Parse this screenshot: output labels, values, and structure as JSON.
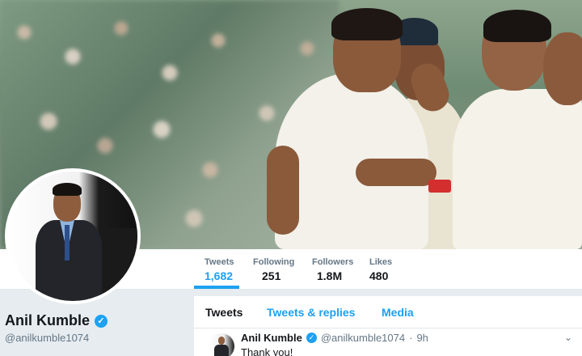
{
  "profile": {
    "name": "Anil Kumble",
    "handle": "@anilkumble1074"
  },
  "stats": [
    {
      "label": "Tweets",
      "value": "1,682"
    },
    {
      "label": "Following",
      "value": "251"
    },
    {
      "label": "Followers",
      "value": "1.8M"
    },
    {
      "label": "Likes",
      "value": "480"
    }
  ],
  "tabs": [
    {
      "label": "Tweets"
    },
    {
      "label": "Tweets & replies"
    },
    {
      "label": "Media"
    }
  ],
  "tweet": {
    "author": "Anil Kumble",
    "handle": "@anilkumble1074",
    "separator": "·",
    "time": "9h",
    "text": "Thank you!"
  },
  "icons": {
    "verified": "verified-badge-icon",
    "more": "chevron-down-icon"
  },
  "colors": {
    "accent": "#1da1f2",
    "text": "#14171a",
    "muted": "#657786",
    "background": "#e6ecf0"
  }
}
